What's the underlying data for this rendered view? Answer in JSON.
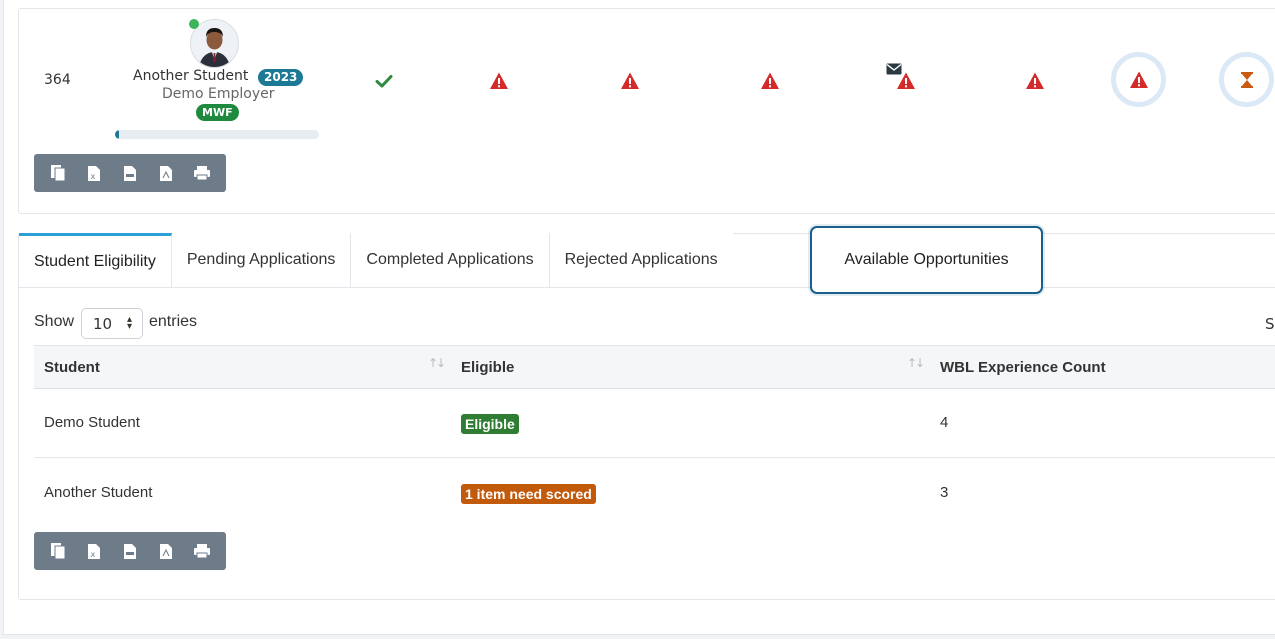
{
  "top_row": {
    "id": "364",
    "student_name": "Another Student",
    "year_badge": "2023",
    "employer": "Demo Employer",
    "schedule_badge": "MWF",
    "progress_fraction": 0.02,
    "statuses": [
      {
        "icon": "check-icon",
        "color": "#2e8b3d"
      },
      {
        "icon": "warning-icon",
        "color": "#d42a2a"
      },
      {
        "icon": "warning-icon",
        "color": "#d42a2a"
      },
      {
        "icon": "warning-icon",
        "color": "#d42a2a"
      },
      {
        "icon": "envelope-warning-icon",
        "color": "#d42a2a"
      },
      {
        "icon": "warning-icon",
        "color": "#d42a2a"
      },
      {
        "icon": "warning-icon",
        "color": "#d42a2a"
      },
      {
        "icon": "hourglass-icon",
        "color": "#c85a12"
      }
    ]
  },
  "export_buttons": [
    "copy-icon",
    "excel-icon",
    "csv-icon",
    "pdf-icon",
    "print-icon"
  ],
  "tabs": {
    "items": [
      {
        "label": "Student Eligibility",
        "active": true
      },
      {
        "label": "Pending Applications",
        "active": false
      },
      {
        "label": "Completed Applications",
        "active": false
      },
      {
        "label": "Rejected Applications",
        "active": false
      },
      {
        "label": "Available Opportunities",
        "active": false,
        "focused": true
      }
    ]
  },
  "table_controls": {
    "show_label": "Show",
    "entries_value": "10",
    "entries_label": "entries",
    "search_partial": "S"
  },
  "table": {
    "headers": [
      "Student",
      "Eligible",
      "WBL Experience Count"
    ],
    "rows": [
      {
        "student": "Demo Student",
        "eligible": "Eligible",
        "eligible_color": "#2e7d32",
        "count": "4"
      },
      {
        "student": "Another Student",
        "eligible": "1 item need scored",
        "eligible_color": "#c25a0c",
        "count": "3"
      }
    ]
  },
  "colors": {
    "accent": "#2a9fd8",
    "teal_badge": "#1c7a96",
    "green_badge": "#1f8a3d",
    "toolbar": "#6e7b89",
    "focus_ring": "#1a5f8a"
  }
}
